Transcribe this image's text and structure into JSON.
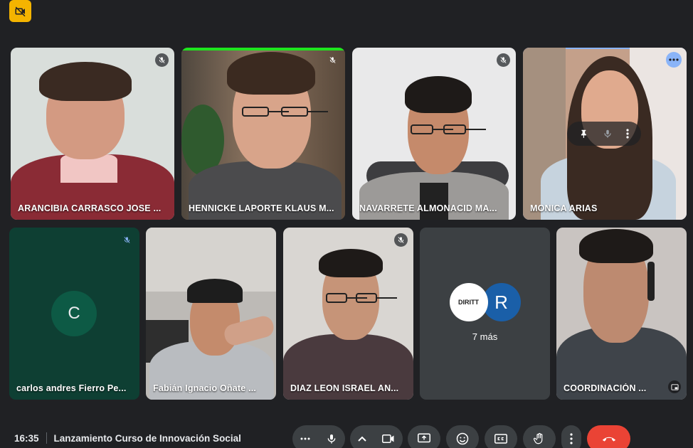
{
  "participants": [
    {
      "name": "ARANCIBIA CARRASCO JOSE ..."
    },
    {
      "name": "HENNICKE LAPORTE KLAUS M..."
    },
    {
      "name": "NAVARRETE ALMONACID MA..."
    },
    {
      "name": "MONICA ARIAS"
    },
    {
      "name": "carlos andres Fierro Pe...",
      "initial": "C"
    },
    {
      "name": "Fabián Ignacio Oñate ..."
    },
    {
      "name": "DIAZ LEON ISRAEL AN..."
    },
    {
      "name": "COORDINACIÓN ..."
    }
  ],
  "others_tile": {
    "logo_text": "DIRITT",
    "avatar_initial": "R",
    "label": "7 más"
  },
  "meeting": {
    "time": "16:35",
    "title": "Lanzamiento Curso de Innovación Social"
  },
  "icons": {
    "top_badge": "camera-off-icon",
    "mute": "mic-off-icon",
    "pin": "pin-icon",
    "mic": "mic-icon",
    "more": "more-vertical-icon",
    "camera": "camera-icon",
    "present": "present-screen-icon",
    "emoji": "emoji-icon",
    "captions": "captions-icon",
    "hand": "raise-hand-icon",
    "end": "end-call-icon"
  },
  "colors": {
    "accent": "#8ab4f8",
    "end_call": "#ea4335",
    "badge": "#f4b400",
    "speaking": "#1ee51e"
  }
}
